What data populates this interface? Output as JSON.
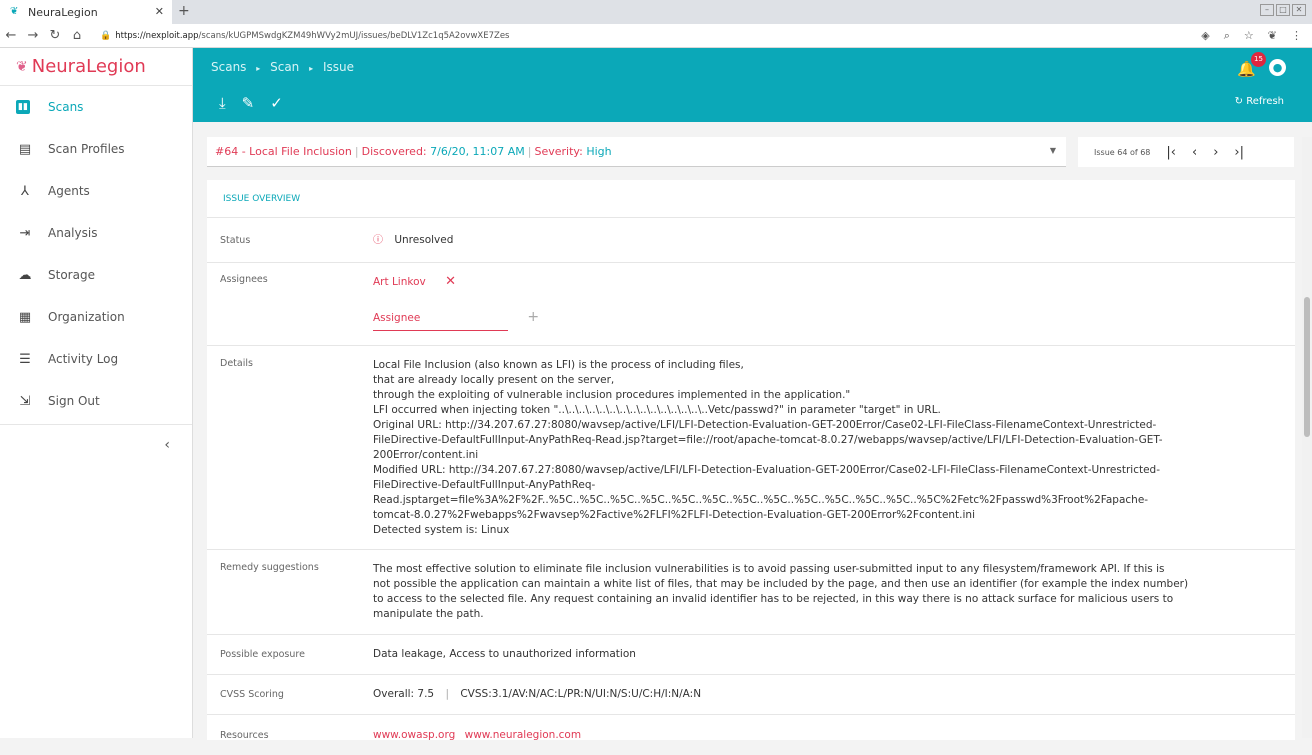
{
  "browser": {
    "tab_title": "NeuraLegion",
    "url_host": "https://nexploit.app",
    "url_path": "/scans/kUGPMSwdgKZM49hWVy2mUJ/issues/beDLV1Zc1q5A2ovwXE7Zes"
  },
  "sidebar": {
    "logo_text": "NeuraLegion",
    "items": [
      {
        "label": "Scans",
        "icon": "bar-chart-icon"
      },
      {
        "label": "Scan Profiles",
        "icon": "profile-icon"
      },
      {
        "label": "Agents",
        "icon": "agents-icon"
      },
      {
        "label": "Analysis",
        "icon": "analysis-icon"
      },
      {
        "label": "Storage",
        "icon": "cloud-icon"
      },
      {
        "label": "Organization",
        "icon": "building-icon"
      },
      {
        "label": "Activity Log",
        "icon": "list-icon"
      },
      {
        "label": "Sign Out",
        "icon": "sign-out-icon"
      }
    ]
  },
  "header": {
    "crumb1": "Scans",
    "crumb2": "Scan",
    "crumb3": "Issue",
    "notification_count": "15",
    "refresh_label": "Refresh"
  },
  "issue": {
    "title": "#64 - Local File Inclusion",
    "discovered_label": "Discovered:",
    "discovered_value": "7/6/20, 11:07 AM",
    "severity_label": "Severity:",
    "severity_value": "High",
    "pager_text": "Issue 64 of 68"
  },
  "overview": {
    "heading": "ISSUE OVERVIEW",
    "status_label": "Status",
    "status_value": "Unresolved",
    "assignees_label": "Assignees",
    "assignee_name": "Art Linkov",
    "assignee_placeholder": "Assignee",
    "details_label": "Details",
    "details_lines": [
      "Local File Inclusion (also known as LFI) is the process of including files,",
      "that are already locally present on the server,",
      "through the exploiting of vulnerable inclusion procedures implemented in the application.\"",
      "LFI occurred when injecting token \"..\\..\\..\\..\\..\\..\\..\\..\\..\\..\\..\\..\\..\\..\\..Vetc/passwd?\" in parameter \"target\" in URL.",
      "Original URL: http://34.207.67.27:8080/wavsep/active/LFI/LFI-Detection-Evaluation-GET-200Error/Case02-LFI-FileClass-FilenameContext-Unrestricted-",
      "FileDirective-DefaultFullInput-AnyPathReq-Read.jsp?target=file://root/apache-tomcat-8.0.27/webapps/wavsep/active/LFI/LFI-Detection-Evaluation-GET-",
      "200Error/content.ini",
      "Modified URL: http://34.207.67.27:8080/wavsep/active/LFI/LFI-Detection-Evaluation-GET-200Error/Case02-LFI-FileClass-FilenameContext-Unrestricted-",
      "FileDirective-DefaultFullInput-AnyPathReq-",
      "Read.jsptarget=file%3A%2F%2F..%5C..%5C..%5C..%5C..%5C..%5C..%5C..%5C..%5C..%5C..%5C..%5C..%5C%2Fetc%2Fpasswd%3Froot%2Fapache-",
      "tomcat-8.0.27%2Fwebapps%2Fwavsep%2Factive%2FLFI%2FLFI-Detection-Evaluation-GET-200Error%2Fcontent.ini",
      "Detected system is: Linux"
    ],
    "remedy_label": "Remedy suggestions",
    "remedy_lines": [
      "The most effective solution to eliminate file inclusion vulnerabilities is to avoid passing user-submitted input to any filesystem/framework API. If this is",
      "not possible the application can maintain a white list of files, that may be included by the page, and then use an identifier (for example the index number)",
      "to access to the selected file. Any request containing an invalid identifier has to be rejected, in this way there is no attack surface for malicious users to",
      "manipulate the path."
    ],
    "exposure_label": "Possible exposure",
    "exposure_value": "Data leakage, Access to unauthorized information",
    "cvss_label": "CVSS Scoring",
    "cvss_overall": "Overall: 7.5",
    "cvss_vector": "CVSS:3.1/AV:N/AC:L/PR:N/UI:N/S:U/C:H/I:N/A:N",
    "resources_label": "Resources",
    "resource_1": "www.owasp.org",
    "resource_2": "www.neuralegion.com"
  }
}
